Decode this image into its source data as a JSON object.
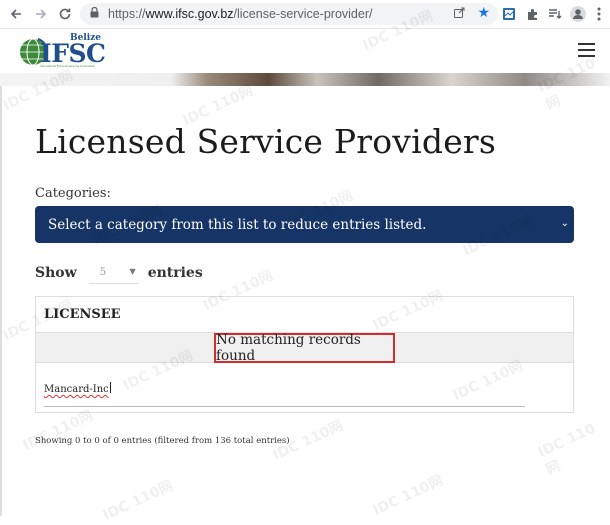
{
  "browser": {
    "url_scheme": "https://",
    "url_domain": "www.ifsc.gov.bz",
    "url_path": "/license-service-provider/"
  },
  "site": {
    "logo_country": "Belize",
    "logo_text": "IFSC",
    "logo_tagline": "International Financial Services Commission"
  },
  "page": {
    "title": "Licensed Service Providers",
    "categories_label": "Categories:",
    "category_placeholder": "Select a category from this list to reduce entries listed.",
    "show_label": "Show",
    "entries_label": "entries",
    "page_length_value": "5"
  },
  "table": {
    "column_header": "LICENSEE",
    "empty_message": "No matching records found",
    "filter_value": "Mancard-Inc",
    "info_text": "Showing 0 to 0 of 0 entries (filtered from 136 total entries)"
  },
  "watermark": "IDC 110网",
  "colors": {
    "category_bar": "#163566",
    "highlight_border": "#d0302d",
    "logo_green": "#3d8a3a",
    "logo_blue": "#1f4e8c"
  },
  "icons": [
    "back-arrow-icon",
    "forward-arrow-icon",
    "reload-icon",
    "lock-icon",
    "share-icon",
    "star-icon",
    "extension-icon",
    "puzzle-icon",
    "reading-list-icon",
    "profile-icon",
    "menu-dots-icon",
    "hamburger-menu-icon",
    "chevron-down-icon"
  ]
}
